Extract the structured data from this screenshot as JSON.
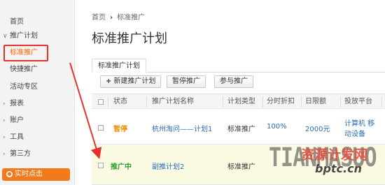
{
  "sidebar": {
    "home": "首页",
    "promotion_plan": "推广计划",
    "standard_promotion": "标准推广",
    "quick_promotion": "快捷推广",
    "activity_zone": "活动专区",
    "reports": "报表",
    "account": "账户",
    "tools": "工具",
    "third_party": "第三方",
    "realtime_click": "实时点击"
  },
  "breadcrumb": {
    "home": "首页",
    "current": "标准推广"
  },
  "page_title": "标准推广计划",
  "tabs": [
    {
      "label": "标准推广计划"
    }
  ],
  "toolbar": {
    "new_plan": "新建推广计划",
    "pause": "暂停推广",
    "join": "参与推广"
  },
  "table": {
    "columns": [
      "状态",
      "推广计划名称",
      "计划类型",
      "分时折扣",
      "日限额",
      "投放平台"
    ],
    "rows": [
      {
        "status": "暂停",
        "name": "杭州淘问——计划1",
        "type": "标准推广",
        "discount": "100%",
        "daily_limit": "2000元",
        "platform_line1": "计算机 移",
        "platform_line2": "动设备"
      },
      {
        "status": "推广中",
        "name": "副推计划2",
        "type": "标准推广",
        "discount": "",
        "daily_limit": "",
        "platform_line1": "",
        "platform_line2": ""
      }
    ]
  },
  "watermark": {
    "latin": "TIANMASUO",
    "chinese": "资源计发网",
    "url": "bptc.cn"
  },
  "colors": {
    "accent": "#ff6600",
    "highlight_box": "#e8312c",
    "link": "#2a6cb5",
    "status_paused": "#f08c00",
    "status_running": "#2e9a2e",
    "realtime_button": "#f27a1a"
  }
}
